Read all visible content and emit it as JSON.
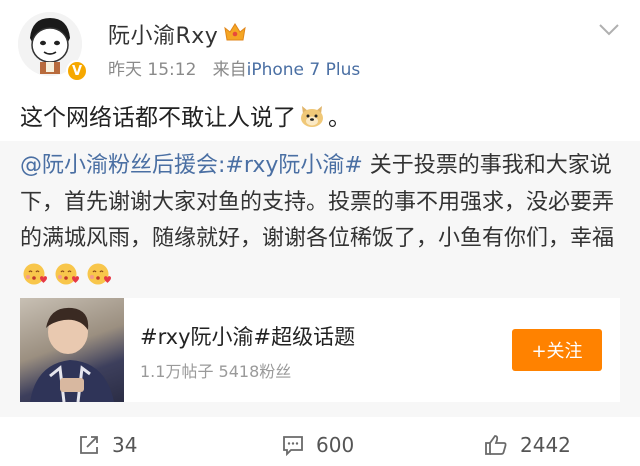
{
  "post": {
    "username": "阮小渝Rxy",
    "time": "昨天 15:12",
    "source_prefix": "来自",
    "source": "iPhone 7 Plus",
    "text": "这个网络话都不敢让人说了",
    "text_end": "。"
  },
  "repost": {
    "mention": "@阮小渝粉丝后援会",
    "topic": ":#rxy阮小渝#",
    "body": " 关于投票的事我和大家说下，首先谢谢大家对鱼的支持。投票的事不用强求，没必要弄的满城风雨，随缘就好，谢谢各位稀饭了，小鱼有你们，幸福",
    "card": {
      "title": "#rxy阮小渝#超级话题",
      "stats": "1.1万帖子  5418粉丝",
      "follow_label": "+关注"
    }
  },
  "actions": {
    "repost_count": "34",
    "comment_count": "600",
    "like_count": "2442"
  },
  "icons": [
    "avatar-cartoon",
    "vip-crown-icon",
    "verified-v-icon",
    "chevron-down-icon",
    "doge-emoji-icon",
    "kiss-emoji-icon",
    "repost-icon",
    "comment-icon",
    "like-icon"
  ],
  "colors": {
    "link": "#4a6fa3",
    "follow_button": "#ff8200",
    "verified": "#f6a800"
  }
}
